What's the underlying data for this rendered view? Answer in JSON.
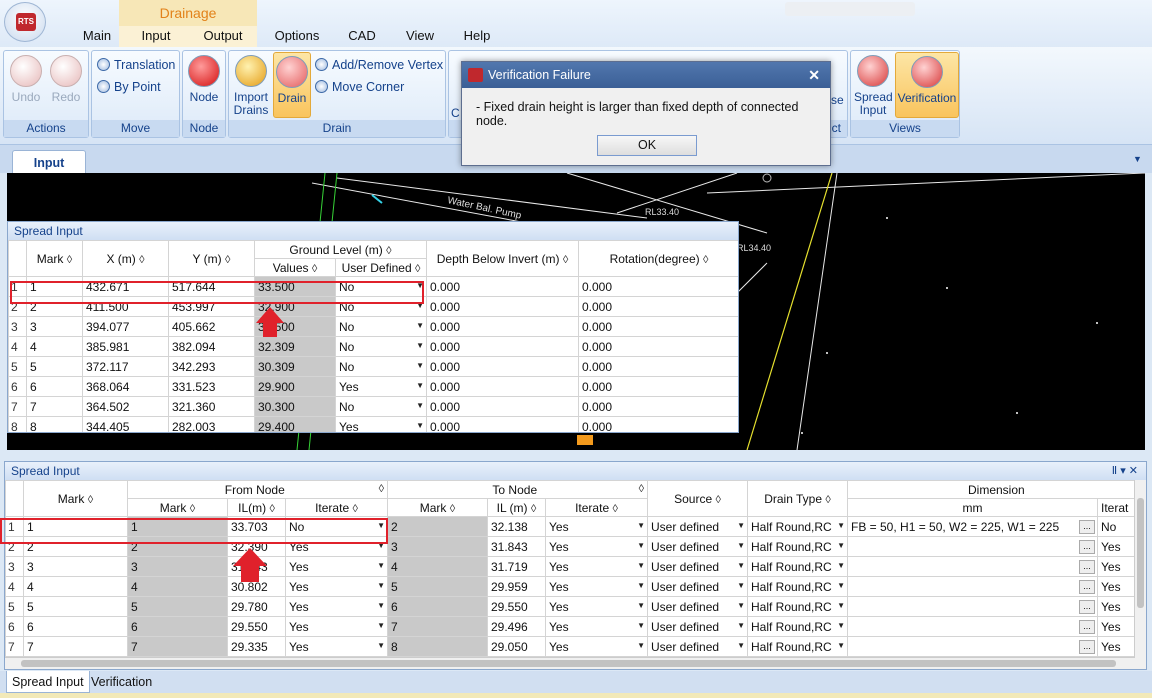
{
  "app": {
    "logo_text": "RTS"
  },
  "ribbon": {
    "context_tab": "Drainage",
    "tabs": [
      "Main",
      "Input",
      "Output",
      "Options",
      "CAD",
      "View",
      "Help"
    ],
    "groups": {
      "actions": {
        "label": "Actions",
        "undo": "Undo",
        "redo": "Redo"
      },
      "move": {
        "label": "Move",
        "translation": "Translation",
        "by_point": "By Point"
      },
      "node": {
        "label": "Node",
        "node": "Node"
      },
      "drain": {
        "label": "Drain",
        "import_drains_1": "Import",
        "import_drains_2": "Drains",
        "drain": "Drain",
        "add_remove_vertex": "Add/Remove Vertex",
        "move_corner": "Move Corner"
      },
      "hidden_group_fragment": "C",
      "hidden_label_fragment": "ct",
      "hidden_button_fragment": "se",
      "views": {
        "label": "Views",
        "spread_input_1": "Spread",
        "spread_input_2": "Input",
        "verification": "Verification"
      }
    }
  },
  "doc_tab": "Input",
  "cad_labels": {
    "pump": "Water Bal. Pump",
    "rl1": "RL33.40",
    "rl2": "RL34.40"
  },
  "dialog": {
    "title": "Verification Failure",
    "message": "- Fixed drain height is larger than fixed depth of connected node.",
    "ok": "OK",
    "close": "✕"
  },
  "node_grid": {
    "title": "Spread Input",
    "headers": {
      "mark": "Mark",
      "x": "X (m)",
      "y": "Y (m)",
      "ground_level": "Ground Level (m)",
      "values": "Values",
      "user_defined": "User Defined",
      "depth": "Depth Below Invert (m)",
      "rotation": "Rotation(degree)"
    },
    "rows": [
      {
        "n": "1",
        "mark": "1",
        "x": "432.671",
        "y": "517.644",
        "gl": "33.500",
        "ud": "No",
        "depth": "0.000",
        "rot": "0.000"
      },
      {
        "n": "2",
        "mark": "2",
        "x": "411.500",
        "y": "453.997",
        "gl": "32.900",
        "ud": "No",
        "depth": "0.000",
        "rot": "0.000"
      },
      {
        "n": "3",
        "mark": "3",
        "x": "394.077",
        "y": "405.662",
        "gl": "32.500",
        "ud": "No",
        "depth": "0.000",
        "rot": "0.000"
      },
      {
        "n": "4",
        "mark": "4",
        "x": "385.981",
        "y": "382.094",
        "gl": "32.309",
        "ud": "No",
        "depth": "0.000",
        "rot": "0.000"
      },
      {
        "n": "5",
        "mark": "5",
        "x": "372.117",
        "y": "342.293",
        "gl": "30.309",
        "ud": "No",
        "depth": "0.000",
        "rot": "0.000"
      },
      {
        "n": "6",
        "mark": "6",
        "x": "368.064",
        "y": "331.523",
        "gl": "29.900",
        "ud": "Yes",
        "depth": "0.000",
        "rot": "0.000"
      },
      {
        "n": "7",
        "mark": "7",
        "x": "364.502",
        "y": "321.360",
        "gl": "30.300",
        "ud": "No",
        "depth": "0.000",
        "rot": "0.000"
      },
      {
        "n": "8",
        "mark": "8",
        "x": "344.405",
        "y": "282.003",
        "gl": "29.400",
        "ud": "Yes",
        "depth": "0.000",
        "rot": "0.000"
      }
    ]
  },
  "drain_grid": {
    "title": "Spread Input",
    "pin": "Ⅱ",
    "headers": {
      "mark": "Mark",
      "from_node": "From Node",
      "to_node": "To Node",
      "node_mark": "Mark",
      "il": "IL(m)",
      "il2": "IL (m)",
      "iterate": "Iterate",
      "source": "Source",
      "drain_type": "Drain Type",
      "dimension": "Dimension",
      "mm": "mm",
      "iterate2": "Iterat"
    },
    "rows": [
      {
        "n": "1",
        "mark": "1",
        "fm": "1",
        "fil": "33.703",
        "fit": "No",
        "tm": "2",
        "til": "32.138",
        "tit": "Yes",
        "src": "User defined",
        "type": "Half Round,RC",
        "dim": "FB = 50, H1 = 50, W2 = 225, W1 = 225",
        "it2": "No"
      },
      {
        "n": "2",
        "mark": "2",
        "fm": "2",
        "fil": "32.390",
        "fit": "Yes",
        "tm": "3",
        "til": "31.843",
        "tit": "Yes",
        "src": "User defined",
        "type": "Half Round,RC",
        "dim": "",
        "it2": "Yes"
      },
      {
        "n": "3",
        "mark": "3",
        "fm": "3",
        "fil": "31.843",
        "fit": "Yes",
        "tm": "4",
        "til": "31.719",
        "tit": "Yes",
        "src": "User defined",
        "type": "Half Round,RC",
        "dim": "",
        "it2": "Yes"
      },
      {
        "n": "4",
        "mark": "4",
        "fm": "4",
        "fil": "30.802",
        "fit": "Yes",
        "tm": "5",
        "til": "29.959",
        "tit": "Yes",
        "src": "User defined",
        "type": "Half Round,RC",
        "dim": "",
        "it2": "Yes"
      },
      {
        "n": "5",
        "mark": "5",
        "fm": "5",
        "fil": "29.780",
        "fit": "Yes",
        "tm": "6",
        "til": "29.550",
        "tit": "Yes",
        "src": "User defined",
        "type": "Half Round,RC",
        "dim": "",
        "it2": "Yes"
      },
      {
        "n": "6",
        "mark": "6",
        "fm": "6",
        "fil": "29.550",
        "fit": "Yes",
        "tm": "7",
        "til": "29.496",
        "tit": "Yes",
        "src": "User defined",
        "type": "Half Round,RC",
        "dim": "",
        "it2": "Yes"
      },
      {
        "n": "7",
        "mark": "7",
        "fm": "7",
        "fil": "29.335",
        "fit": "Yes",
        "tm": "8",
        "til": "29.050",
        "tit": "Yes",
        "src": "User defined",
        "type": "Half Round,RC",
        "dim": "",
        "it2": "Yes"
      }
    ]
  },
  "bottom_tabs": [
    "Spread Input",
    "Verification"
  ],
  "colors": {
    "highlight": "#e0212b",
    "ribbon_active": "#f9c45d",
    "dialog_title": "#3b5f96"
  }
}
